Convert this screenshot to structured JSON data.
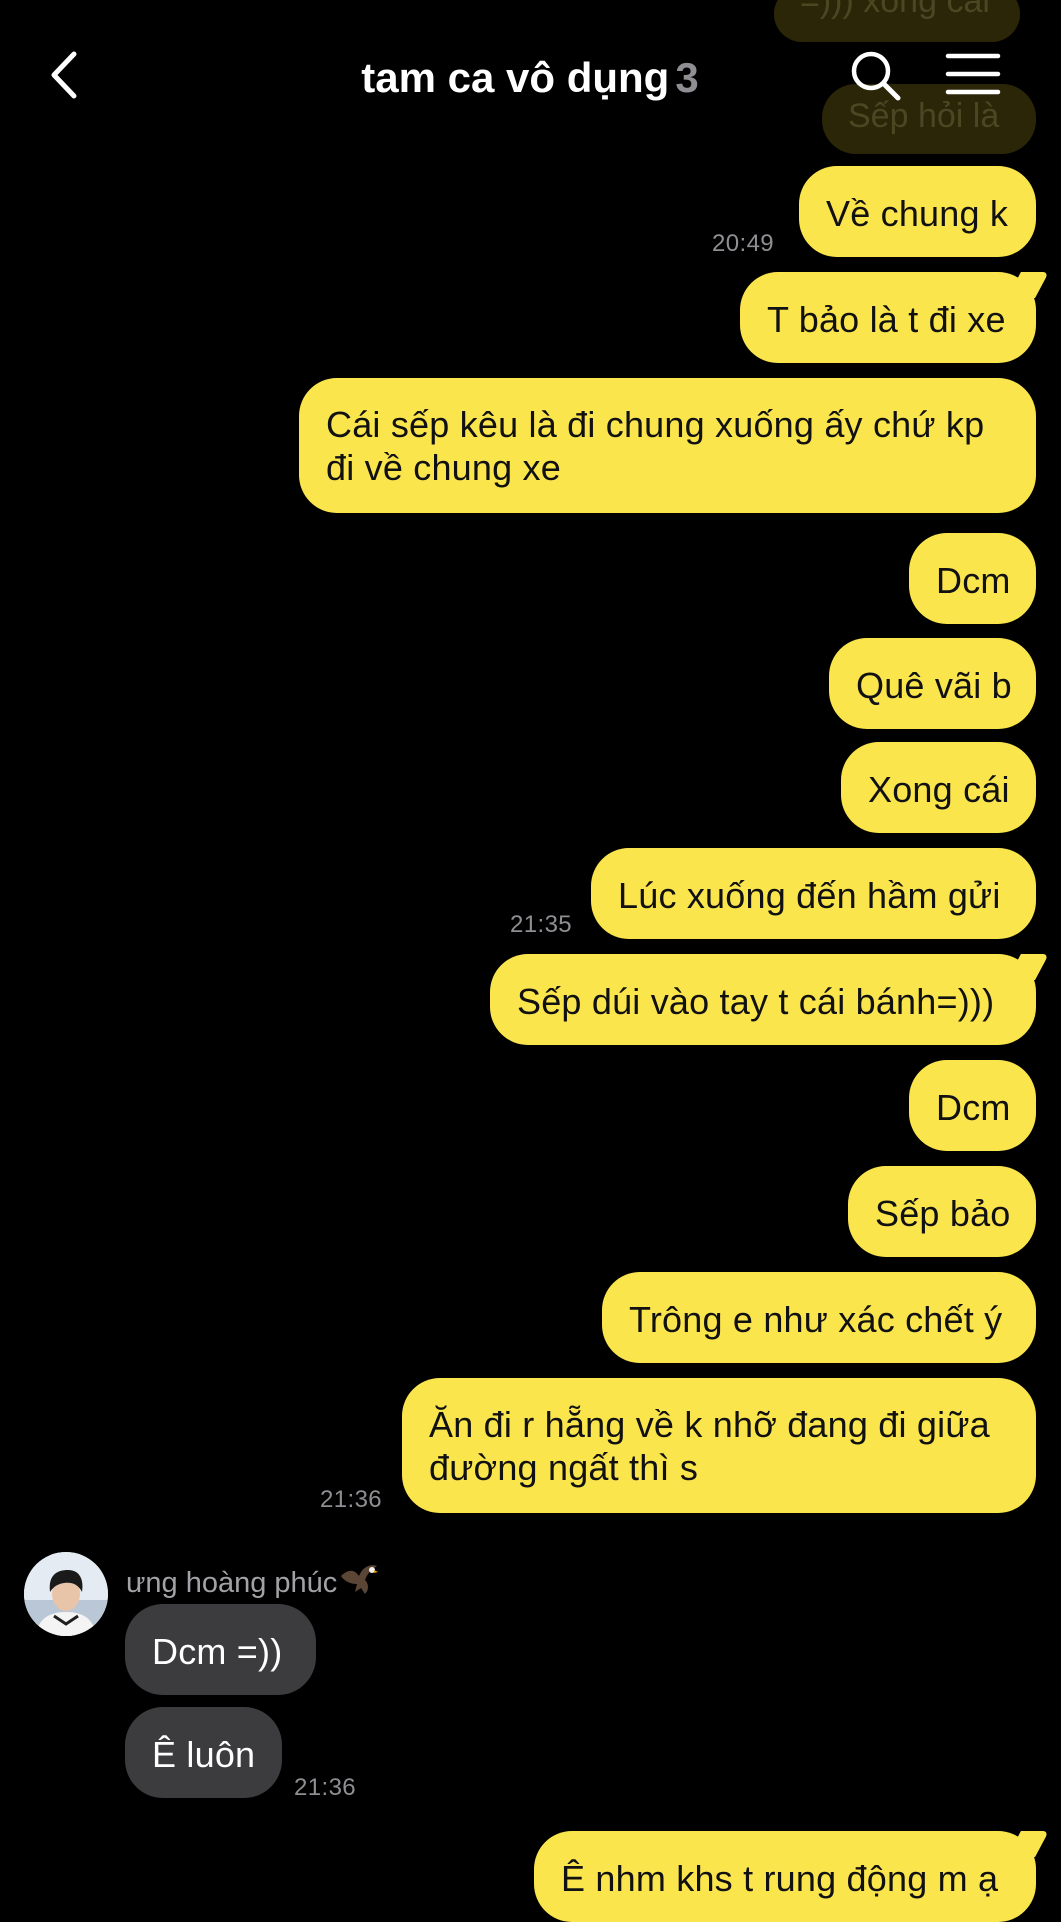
{
  "header": {
    "back_icon": "chevron-left-icon",
    "title": "tam ca vô dụng",
    "member_count": "3",
    "search_icon": "search-icon",
    "menu_icon": "hamburger-menu-icon"
  },
  "faded_top": {
    "line1": "=))) xong cái",
    "line2": "Sếp hỏi là"
  },
  "messages": [
    {
      "text": "Về chung k",
      "time": "20:49"
    },
    {
      "text": "T bảo là t đi xe"
    },
    {
      "line1": "Cái sếp kêu là đi chung xuống ấy chứ kp",
      "line2": "đi về chung xe"
    },
    {
      "text": "Dcm"
    },
    {
      "text": "Quê vãi b"
    },
    {
      "text": "Xong cái"
    },
    {
      "text": "Lúc xuống đến hầm gửi",
      "time": "21:35"
    },
    {
      "text": "Sếp dúi vào tay t cái bánh=)))"
    },
    {
      "text": "Dcm"
    },
    {
      "text": "Sếp bảo"
    },
    {
      "text": "Trông e như xác chết ý"
    },
    {
      "line1": "Ăn đi r hẵng về k nhỡ đang đi giữa",
      "line2": "đường ngất thì s",
      "time": "21:36"
    }
  ],
  "incoming": {
    "sender_name": "ưng hoàng phúc",
    "sender_emoji": "eagle",
    "avatar_icon": "profile-photo",
    "messages": [
      {
        "text": "Dcm =))"
      },
      {
        "text": "Ê luôn",
        "time": "21:36"
      }
    ]
  },
  "last_message": {
    "text": "Ê nhm khs t rung động m ạ"
  },
  "colors": {
    "background": "#000000",
    "my_bubble": "#FBE54D",
    "their_bubble": "#3C3C3E",
    "timestamp": "#8E8E93"
  }
}
